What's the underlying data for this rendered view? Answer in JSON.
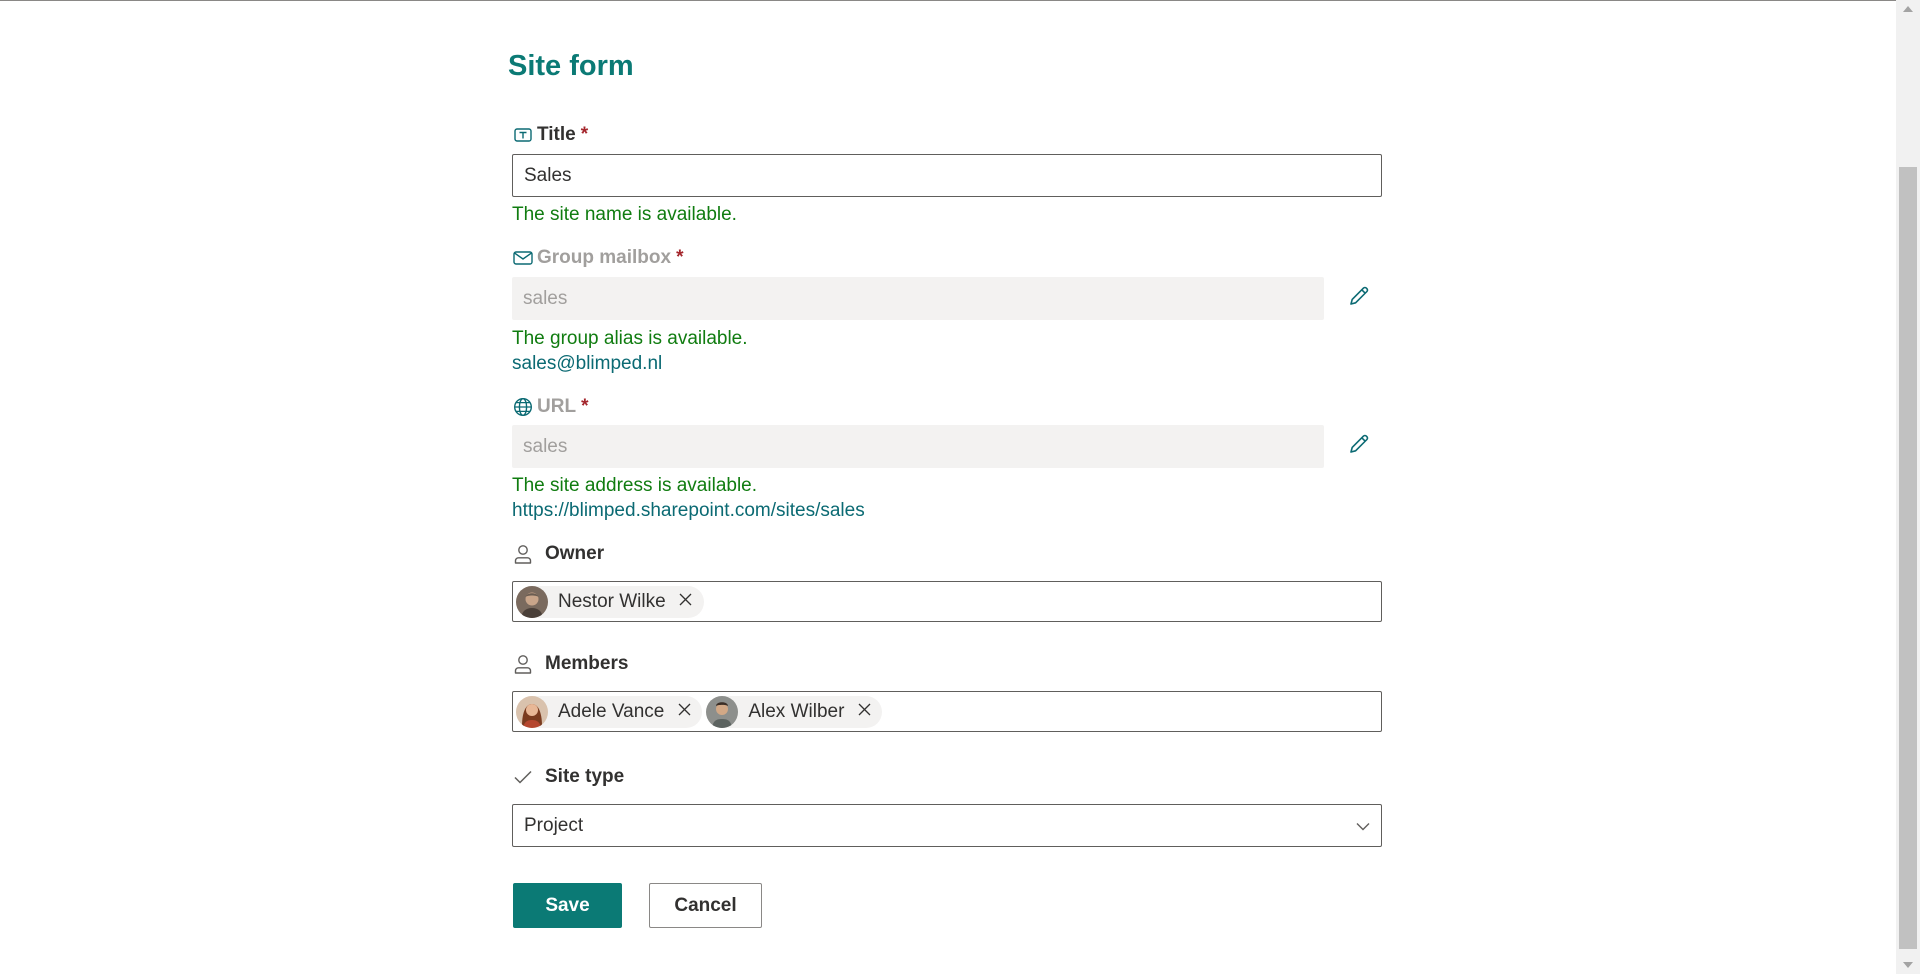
{
  "form": {
    "title": "Site form",
    "title_field": {
      "label": "Title",
      "required": "*",
      "value": "Sales",
      "message": "The site name is available."
    },
    "mailbox_field": {
      "label": "Group mailbox",
      "required": "*",
      "value": "sales",
      "message": "The group alias is available.",
      "link": "sales@blimped.nl"
    },
    "url_field": {
      "label": "URL",
      "required": "*",
      "value": "sales",
      "message": "The site address is available.",
      "link": "https://blimped.sharepoint.com/sites/sales"
    },
    "owner_field": {
      "label": "Owner",
      "people": [
        {
          "name": "Nestor Wilke"
        }
      ]
    },
    "members_field": {
      "label": "Members",
      "people": [
        {
          "name": "Adele Vance"
        },
        {
          "name": "Alex Wilber"
        }
      ]
    },
    "site_type_field": {
      "label": "Site type",
      "selected": "Project"
    },
    "buttons": {
      "save": "Save",
      "cancel": "Cancel"
    }
  },
  "colors": {
    "accent": "#0b7a75",
    "success": "#107c10",
    "required": "#a4262c",
    "link": "#0b6a73"
  },
  "icons": {
    "title": "text-field-icon",
    "mailbox": "mail-icon",
    "url": "globe-icon",
    "owner": "person-icon",
    "members": "person-icon",
    "site_type": "checkmark-icon",
    "edit": "pencil-icon",
    "remove": "close-icon",
    "dropdown": "chevron-down-icon"
  }
}
